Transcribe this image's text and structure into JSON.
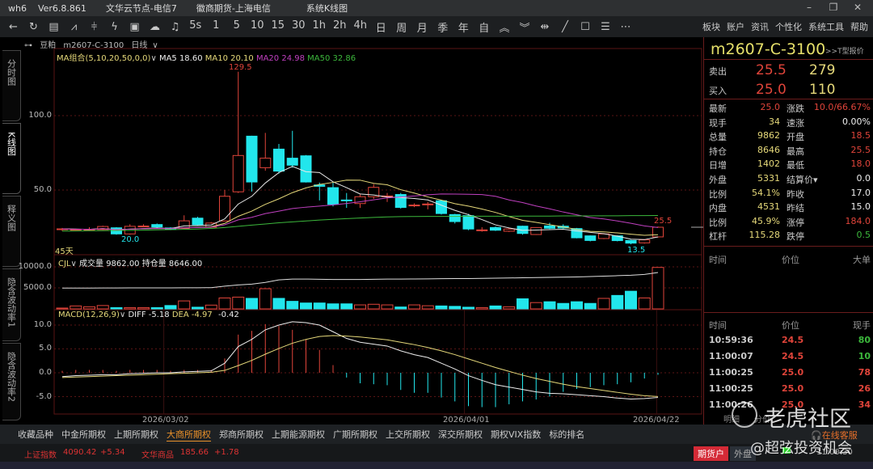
{
  "title_bar": {
    "app": "wh6",
    "version": "Ver6.8.861",
    "node": "文华云节点-电信7",
    "broker": "徽商期货-上海电信",
    "view": "系统K线图"
  },
  "toolbar": {
    "icons": [
      "back-icon",
      "refresh-icon",
      "table-icon",
      "line-chart-icon",
      "candle-icon",
      "lightning-icon",
      "option-icon",
      "cloud-icon",
      "bell-icon"
    ],
    "periods": [
      "5s",
      "1",
      "5",
      "10",
      "15",
      "30",
      "1h",
      "2h",
      "4h",
      "日",
      "周",
      "月",
      "季",
      "年",
      "自"
    ],
    "right_menu": [
      "板块",
      "账户",
      "资讯",
      "个性化",
      "系统工具",
      "帮助"
    ]
  },
  "breadcrumb": {
    "variety": "豆粕",
    "contract": "m2607-C-3100",
    "period": "日线"
  },
  "left_tabs": [
    "分时图",
    "K线图",
    "释义图",
    "隐含波动率1",
    "隐含波动率2"
  ],
  "legend": {
    "ma_group": "MA组合(5,10,20,50,0,0)",
    "ma5": "MA5 18.60",
    "ma10": "MA10 20.10",
    "ma20": "MA20 24.98",
    "ma50": "MA50 32.86",
    "days": "45天",
    "high_label": "129.5",
    "low_label": "20.0",
    "recent_low": "13.5",
    "last_high": "25.5"
  },
  "volume_legend": {
    "name": "CJL",
    "vol": "成交量 9862.00",
    "oi": "持仓量 8646.00"
  },
  "macd_legend": {
    "name": "MACD(12,26,9)",
    "diff": "DIFF -5.18",
    "dea": "DEA -4.97",
    "macd": "-0.42"
  },
  "colors": {
    "up": "#e0443a",
    "down": "#22e6ec",
    "ma5": "#e8e8e8",
    "ma10": "#e6d97a",
    "ma20": "#c040c0",
    "ma50": "#3cb83c",
    "grid": "#5a1414",
    "accent": "#e8902a"
  },
  "chart_data": {
    "type": "candlestick",
    "price_axis": {
      "ticks": [
        "100.0",
        "50.0"
      ],
      "tick_values": [
        100,
        50
      ]
    },
    "volume_axis": {
      "ticks": [
        "10000.0",
        "5000.0"
      ],
      "tick_values": [
        10000,
        5000
      ]
    },
    "macd_axis": {
      "ticks": [
        "10.0",
        "5.0",
        "0.0",
        "-5.0"
      ],
      "tick_values": [
        10,
        5,
        0,
        -5
      ]
    },
    "date_labels": [
      {
        "label": "2026/03/02",
        "index": 7.5
      },
      {
        "label": "2026/04/01",
        "index": 29.7
      },
      {
        "label": "2026/04/22",
        "index": 43.9
      }
    ],
    "ohlc": [
      [
        23.5,
        23.9,
        24.5,
        22.5
      ],
      [
        23.3,
        23.5,
        24,
        22.8
      ],
      [
        23,
        23.3,
        25,
        22.5
      ],
      [
        23.4,
        25.5,
        26,
        23
      ],
      [
        24.6,
        20.5,
        25,
        20
      ],
      [
        20.5,
        25.6,
        27,
        20
      ],
      [
        25.6,
        25.8,
        27,
        25
      ],
      [
        26.8,
        25.2,
        27.5,
        24.8
      ],
      [
        24.5,
        23.5,
        25,
        23
      ],
      [
        24.2,
        29.3,
        33,
        24
      ],
      [
        31.1,
        26.7,
        32,
        26
      ],
      [
        25,
        27.8,
        28.5,
        24.8
      ],
      [
        29.2,
        45.8,
        50,
        29
      ],
      [
        48.8,
        73.2,
        129.5,
        48
      ],
      [
        86.2,
        55.4,
        86.5,
        49
      ],
      [
        65,
        71.4,
        88.4,
        63
      ],
      [
        77.5,
        62.7,
        81,
        61
      ],
      [
        71.4,
        66.7,
        89.8,
        65
      ],
      [
        73,
        55.4,
        73.5,
        55
      ],
      [
        53.4,
        52.5,
        55,
        43
      ],
      [
        51.6,
        40.4,
        55,
        39
      ],
      [
        43.3,
        43,
        48,
        38
      ],
      [
        40.9,
        45.5,
        47,
        38
      ],
      [
        45.5,
        51.8,
        54,
        44
      ],
      [
        45.8,
        46,
        48,
        42
      ],
      [
        47,
        38.3,
        48,
        37.5
      ],
      [
        39.7,
        39.9,
        41,
        38.5
      ],
      [
        40.4,
        40.6,
        42,
        37
      ],
      [
        42.8,
        34.2,
        43,
        33.5
      ],
      [
        33.5,
        28.8,
        34,
        27.5
      ],
      [
        32.8,
        23.8,
        34,
        23
      ],
      [
        23,
        23.2,
        25,
        22
      ],
      [
        24.8,
        23,
        25.5,
        22.5
      ],
      [
        22.3,
        23.8,
        24.5,
        21.8
      ],
      [
        25.7,
        20.8,
        26,
        20
      ],
      [
        20.1,
        24.8,
        25,
        19.8
      ],
      [
        25.9,
        24.3,
        28,
        23.8
      ],
      [
        25.7,
        24.5,
        27,
        24
      ],
      [
        24.1,
        17.9,
        24.5,
        17.5
      ],
      [
        19.2,
        16.1,
        19.5,
        15.5
      ],
      [
        17.4,
        20.5,
        21,
        17
      ],
      [
        19.2,
        16,
        19.5,
        15.5
      ],
      [
        16.1,
        14.3,
        16.5,
        13.5
      ],
      [
        14.5,
        16.5,
        17,
        14
      ],
      [
        18.5,
        25,
        25.5,
        18
      ]
    ],
    "ma50": [
      22.4,
      22.5,
      22.6,
      22.7,
      22.8,
      22.9,
      23,
      23.2,
      23.4,
      23.6,
      23.8,
      24.2,
      24.8,
      25.6,
      26.4,
      27.2,
      28,
      28.6,
      29.2,
      29.8,
      30.3,
      30.8,
      31.2,
      31.6,
      31.9,
      32.1,
      32.2,
      32.3,
      32.3,
      32.3,
      32.4,
      32.4,
      32.4,
      32.4,
      32.5,
      32.5,
      32.5,
      32.6,
      32.6,
      32.6,
      32.7,
      32.7,
      32.8,
      32.8,
      32.86
    ],
    "volume": [
      200,
      700,
      500,
      800,
      300,
      300,
      300,
      300,
      800,
      1900,
      400,
      900,
      2600,
      2800,
      2500,
      4800,
      2500,
      1800,
      1400,
      1400,
      1200,
      1200,
      950,
      1100,
      950,
      450,
      950,
      750,
      700,
      600,
      400,
      300,
      700,
      500,
      2400,
      1500,
      1700,
      1300,
      1700,
      1300,
      2500,
      3200,
      4200,
      2600,
      9862
    ],
    "open_interest": [
      4950,
      4950,
      4960,
      4970,
      4980,
      4990,
      5000,
      5000,
      5010,
      5020,
      5030,
      5050,
      5400,
      5700,
      5900,
      6300,
      6900,
      7100,
      7100,
      7050,
      7000,
      7000,
      7000,
      7050,
      7080,
      7100,
      7120,
      7150,
      7180,
      7200,
      7200,
      7250,
      7300,
      7350,
      7400,
      7450,
      7500,
      7550,
      7600,
      7700,
      7800,
      7900,
      8000,
      8200,
      8646
    ],
    "diff": [
      -0.8,
      -0.6,
      -0.5,
      -0.4,
      -0.4,
      -0.2,
      -0.1,
      0,
      0,
      0.2,
      0.3,
      0.4,
      2.0,
      5.5,
      7.0,
      9.0,
      10.0,
      10.7,
      10.5,
      10.0,
      8.6,
      7.2,
      6.4,
      6.0,
      5.6,
      4.6,
      3.8,
      3.2,
      2.0,
      0.8,
      -0.6,
      -1.6,
      -2.5,
      -3.0,
      -3.5,
      -4.0,
      -4.3,
      -4.4,
      -4.6,
      -4.8,
      -5.0,
      -5.3,
      -5.5,
      -5.4,
      -5.18
    ],
    "dea": [
      -1,
      -0.9,
      -0.8,
      -0.7,
      -0.6,
      -0.5,
      -0.4,
      -0.3,
      -0.2,
      -0.1,
      0,
      0.1,
      0.5,
      1.5,
      2.6,
      3.9,
      5.1,
      6.2,
      7.0,
      7.6,
      7.8,
      7.7,
      7.5,
      7.2,
      6.9,
      6.4,
      5.9,
      5.3,
      4.6,
      3.8,
      2.9,
      2.0,
      1.1,
      0.3,
      -0.5,
      -1.2,
      -1.8,
      -2.4,
      -2.9,
      -3.3,
      -3.7,
      -4.1,
      -4.5,
      -4.8,
      -4.97
    ]
  },
  "quote": {
    "symbol": "m2607-C-3100",
    "t_quote": ">>T型报价",
    "ask_label": "卖出",
    "ask": "25.5",
    "ask_vol": "279",
    "bid_label": "买入",
    "bid": "25.0",
    "bid_vol": "110",
    "rows": [
      {
        "l1": "最新",
        "v1": "25.0",
        "c1": "#e0443a",
        "l2": "涨跌",
        "v2": "10.0/66.67%",
        "c2": "#e0443a"
      },
      {
        "l1": "现手",
        "v1": "34",
        "c1": "#e6d97a",
        "l2": "速涨",
        "v2": "0.00%",
        "c2": "#eee"
      },
      {
        "l1": "总量",
        "v1": "9862",
        "c1": "#e6d97a",
        "l2": "开盘",
        "v2": "18.5",
        "c2": "#e0443a"
      },
      {
        "l1": "持仓",
        "v1": "8646",
        "c1": "#e6d97a",
        "l2": "最高",
        "v2": "25.5",
        "c2": "#e0443a"
      },
      {
        "l1": "日增",
        "v1": "1402",
        "c1": "#e6d97a",
        "l2": "最低",
        "v2": "18.0",
        "c2": "#e0443a"
      },
      {
        "l1": "外盘",
        "v1": "5331",
        "c1": "#e6d97a",
        "l2": "结算价▾",
        "v2": "0.0",
        "c2": "#eee"
      },
      {
        "l1": "比例",
        "v1": "54.1%",
        "c1": "#e6d97a",
        "l2": "昨收",
        "v2": "17.0",
        "c2": "#eee"
      },
      {
        "l1": "内盘",
        "v1": "4531",
        "c1": "#e6d97a",
        "l2": "昨结",
        "v2": "15.0",
        "c2": "#eee"
      },
      {
        "l1": "比例",
        "v1": "45.9%",
        "c1": "#e6d97a",
        "l2": "涨停",
        "v2": "184.0",
        "c2": "#e0443a"
      },
      {
        "l1": "杠杆",
        "v1": "115.28",
        "c1": "#e6d97a",
        "l2": "跌停",
        "v2": "0.5",
        "c2": "#3cb83c"
      }
    ],
    "big_header": [
      "时间",
      "价位",
      "大单"
    ],
    "tick_header": [
      "时间",
      "价位",
      "现手"
    ],
    "ticks": [
      {
        "time": "10:59:36",
        "price": "24.5",
        "vol": "80",
        "vc": "#3cb83c"
      },
      {
        "time": "11:00:07",
        "price": "24.5",
        "vol": "10",
        "vc": "#3cb83c"
      },
      {
        "time": "11:00:25",
        "price": "25.0",
        "vol": "78",
        "vc": "#e0443a"
      },
      {
        "time": "11:00:25",
        "price": "25.0",
        "vol": "26",
        "vc": "#e0443a"
      },
      {
        "time": "11:00:26",
        "price": "25.0",
        "vol": "34",
        "vc": "#e0443a"
      }
    ],
    "bottom_tabs": [
      "明细",
      "分价"
    ]
  },
  "bottom_tabs": [
    "收藏品种",
    "中金所期权",
    "上期所期权",
    "大商所期权",
    "郑商所期权",
    "上期能源期权",
    "广期所期权",
    "上交所期权",
    "深交所期权",
    "期权VIX指数",
    "标的排名"
  ],
  "status": {
    "idx1_name": "上证指数",
    "idx1_val": "4090.42",
    "idx1_chg": "+5.34",
    "idx2_name": "文华商品",
    "idx2_val": "185.66",
    "idx2_chg": "+1.78",
    "account_btn": "期货户",
    "outer_btn": "外盘",
    "service": "在线客服",
    "time": "11:00:30"
  },
  "watermark": {
    "brand": "老虎社区",
    "author": "@超弦投资机会"
  }
}
